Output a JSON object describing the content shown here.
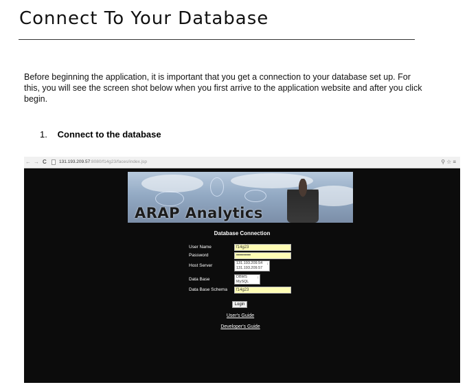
{
  "doc": {
    "title": "Connect To Your Database",
    "intro": "Before beginning the application, it is important that you get a connection to your database set up.  For this, you will see the screen shot below when you first arrive to the application website and after you click begin.",
    "step_number": "1.",
    "step_label": "Connect to the database"
  },
  "browser": {
    "url_host": "131.193.209.57",
    "url_path": ":8080/f14g23/faces/index.jsp",
    "back_icon": "back-arrow-icon",
    "forward_icon": "forward-arrow-icon",
    "reload_icon": "reload-icon",
    "toolbar_icons": [
      "key-icon",
      "star-icon",
      "menu-icon"
    ]
  },
  "app": {
    "banner_brand": "ARAP Analytics",
    "heading": "Database Connection",
    "fields": {
      "username_label": "User Name",
      "username_value": "f14g23",
      "password_label": "Password",
      "password_value": "••••••••••",
      "host_label": "Host Server",
      "host_options": [
        "131.193.209.54",
        "131.193.209.57"
      ],
      "database_label": "Data Base",
      "database_options": [
        "DBMS",
        "MySQL"
      ],
      "schema_label": "Data Base Schema",
      "schema_value": "f14g23"
    },
    "login_label": "Login",
    "users_guide": "User's Guide",
    "developers_guide": "Developer's Guide"
  },
  "colors": {
    "input_bg": "#fffdb5",
    "app_bg": "#0c0c0c"
  }
}
